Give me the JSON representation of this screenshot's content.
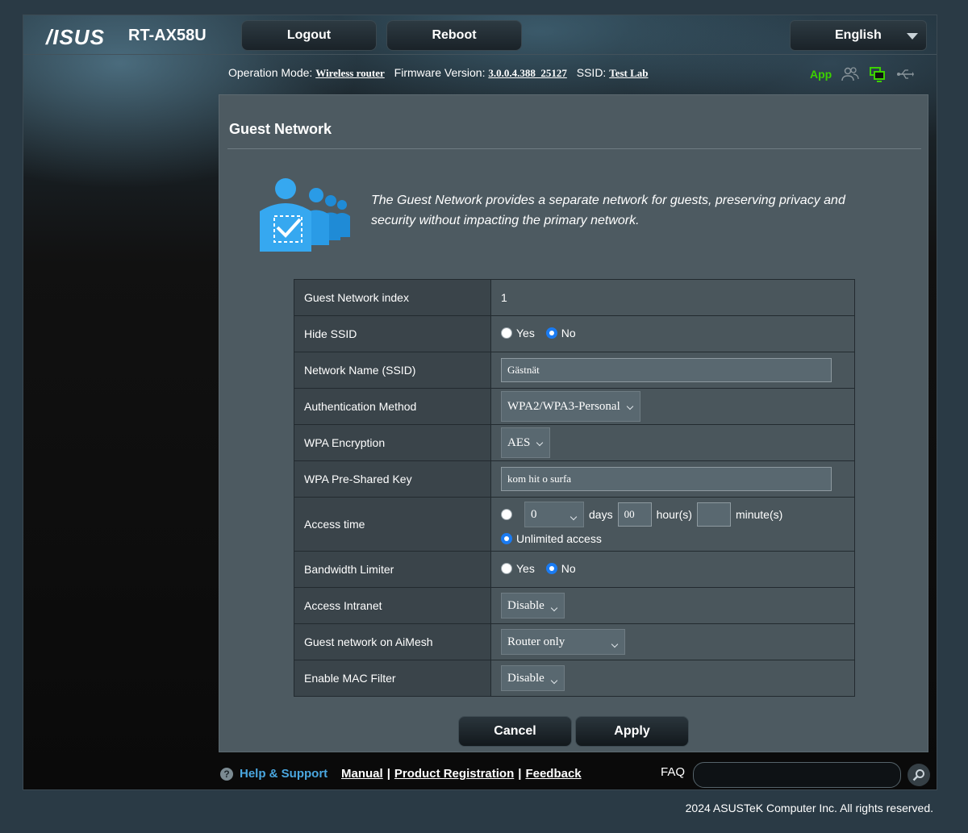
{
  "header": {
    "logo": "/ISUS",
    "model": "RT-AX58U",
    "logout_label": "Logout",
    "reboot_label": "Reboot",
    "language": "English"
  },
  "status": {
    "operation_mode_label": "Operation Mode:",
    "operation_mode_value": "Wireless router",
    "firmware_label": "Firmware Version:",
    "firmware_value": "3.0.0.4.388_25127",
    "ssid_label": "SSID:",
    "ssid_value": "Test Lab",
    "app_label": "App"
  },
  "page": {
    "title": "Guest Network",
    "description": "The Guest Network provides a separate network for guests, preserving privacy and security without impacting the primary network."
  },
  "settings": {
    "index_label": "Guest Network index",
    "index_value": "1",
    "hide_ssid_label": "Hide SSID",
    "yes_label": "Yes",
    "no_label": "No",
    "ssid_label": "Network Name (SSID)",
    "ssid_value": "Gästnät",
    "auth_label": "Authentication Method",
    "auth_value": "WPA2/WPA3-Personal",
    "encryption_label": "WPA Encryption",
    "encryption_value": "AES",
    "psk_label": "WPA Pre-Shared Key",
    "psk_value": "kom hit o surfa",
    "access_time_label": "Access time",
    "days_value": "0",
    "days_label": "days",
    "hours_value": "00",
    "hours_label": "hour(s)",
    "minutes_value": "",
    "minutes_label": "minute(s)",
    "unlimited_label": "Unlimited access",
    "bandwidth_label": "Bandwidth Limiter",
    "intranet_label": "Access Intranet",
    "intranet_value": "Disable",
    "aimesh_label": "Guest network on AiMesh",
    "aimesh_value": "Router only",
    "mac_filter_label": "Enable MAC Filter",
    "mac_filter_value": "Disable"
  },
  "actions": {
    "cancel_label": "Cancel",
    "apply_label": "Apply"
  },
  "footer": {
    "help_label": "Help & Support",
    "manual_label": "Manual",
    "registration_label": "Product Registration",
    "feedback_label": "Feedback",
    "faq_label": "FAQ",
    "copyright": "2024 ASUSTeK Computer Inc. All rights reserved."
  },
  "colors": {
    "accent_green": "#3cd100",
    "radio_selected": "#1a7bf2",
    "help_link": "#4aa7e0"
  }
}
